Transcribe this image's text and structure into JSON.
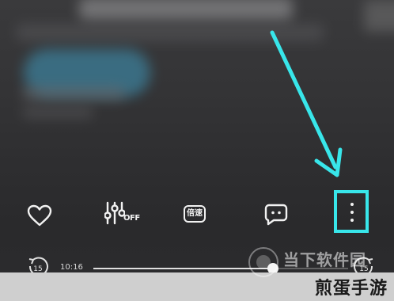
{
  "controls": {
    "like_icon": "heart-outline-icon",
    "equalizer_icon": "equalizer-sliders-icon",
    "equalizer_state": "OFF",
    "speed_label": "倍速",
    "comment_icon": "comment-bubble-icon",
    "more_icon": "vertical-ellipsis-icon"
  },
  "playback": {
    "current_time": "10:16",
    "rewind_seconds": "15",
    "forward_seconds": "15"
  },
  "watermark": {
    "top_text": "当下软件园",
    "main_text": "煎蛋手游"
  },
  "colors": {
    "highlight": "#38e6ea",
    "background": "#2e2e30",
    "band": "#cfcfcf"
  }
}
